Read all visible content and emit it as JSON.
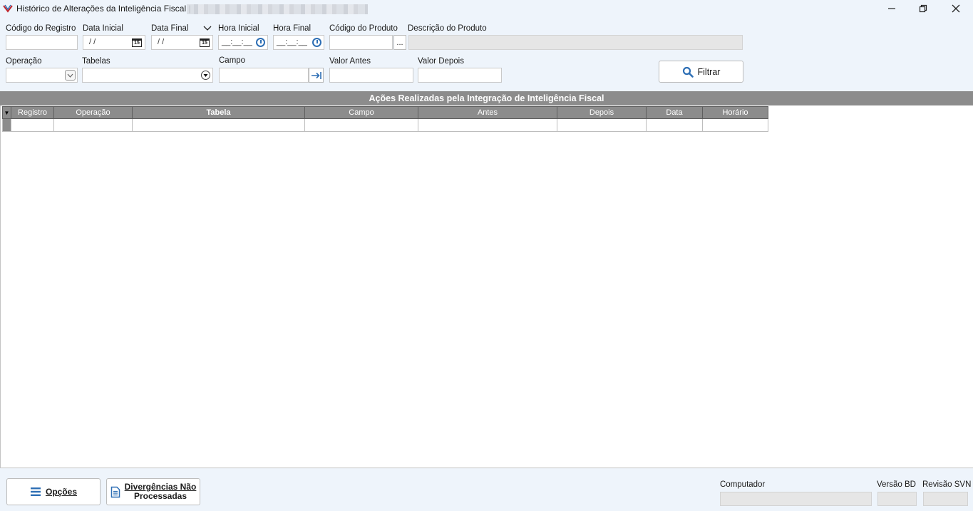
{
  "window": {
    "title": "Histórico de Alterações da Inteligência Fiscal |",
    "controls": {
      "minimize": "—",
      "restore": "❐",
      "close": "✕"
    }
  },
  "filters": {
    "codigo_registro": {
      "label": "Código do Registro",
      "value": ""
    },
    "data_inicial": {
      "label": "Data Inicial",
      "value": " / /"
    },
    "data_final": {
      "label": "Data Final",
      "value": " / /"
    },
    "hora_inicial": {
      "label": "Hora Inicial",
      "value": "__:__:__"
    },
    "hora_final": {
      "label": "Hora Final",
      "value": "__:__:__"
    },
    "codigo_produto": {
      "label": "Código do Produto",
      "value": "",
      "lookup_label": "..."
    },
    "descricao_produto": {
      "label": "Descrição do Produto",
      "value": ""
    },
    "operacao": {
      "label": "Operação",
      "value": ""
    },
    "tabelas": {
      "label": "Tabelas",
      "value": ""
    },
    "campo": {
      "label": "Campo",
      "value": ""
    },
    "valor_antes": {
      "label": "Valor Antes",
      "value": ""
    },
    "valor_depois": {
      "label": "Valor Depois",
      "value": ""
    },
    "filtrar_button": {
      "label": "Filtrar"
    }
  },
  "grid": {
    "title": "Ações Realizadas pela Integração de Inteligência Fiscal",
    "columns": [
      "Registro",
      "Operação",
      "Tabela",
      "Campo",
      "Antes",
      "Depois",
      "Data",
      "Horário"
    ]
  },
  "footer": {
    "opcoes_button": "Opções",
    "divergencias_button_line1": "Divergências Não",
    "divergencias_button_line2": "Processadas",
    "computador_label": "Computador",
    "versao_bd_label": "Versão BD",
    "revisao_svn_label": "Revisão SVN"
  },
  "colors": {
    "accent": "#2e6fb5",
    "header_gray": "#8c8c8c",
    "background": "#eef4fb"
  }
}
